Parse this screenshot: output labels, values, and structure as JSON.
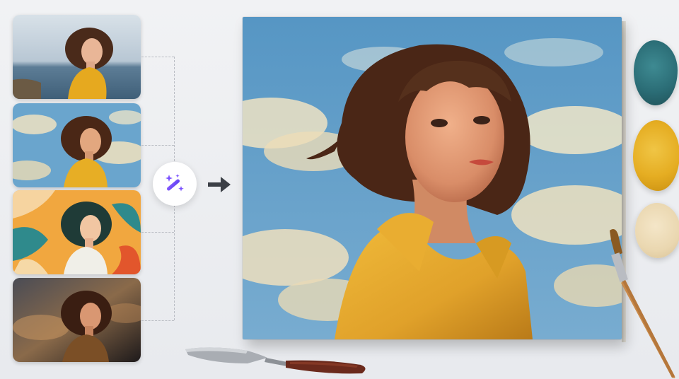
{
  "thumbnails": [
    {
      "name": "original-photo",
      "bg_top": "#c9d5df",
      "bg_bottom": "#4d6f8a",
      "jacket": "#e6a91f"
    },
    {
      "name": "impressionist-style",
      "bg_top": "#5b9ac4",
      "bg_bottom": "#88b6d6",
      "jacket": "#e7ae25"
    },
    {
      "name": "pop-art-style",
      "bg_top": "#ef9f3b",
      "bg_bottom": "#2f8a8c",
      "jacket": "#f0efe8"
    },
    {
      "name": "dramatic-style",
      "bg_top": "#3b3d45",
      "bg_bottom": "#1d1a1c",
      "jacket": "#7b4f26"
    }
  ],
  "magic_button": {
    "icon": "magic-wand-sparkles-icon",
    "color": "#6d4aff"
  },
  "arrow": {
    "icon": "arrow-right-icon",
    "color": "#3b3f46"
  },
  "canvas": {
    "sky": "#5b9bc6",
    "cloud": "#efe6c9",
    "jacket": "#e3a728",
    "hair": "#4a2616"
  },
  "paints": [
    {
      "name": "teal-paint",
      "color": "#2b6d76"
    },
    {
      "name": "yellow-paint",
      "color": "#e5ad22"
    },
    {
      "name": "cream-paint",
      "color": "#ead7b0"
    }
  ],
  "tools": [
    "paint-brush",
    "palette-knife"
  ]
}
